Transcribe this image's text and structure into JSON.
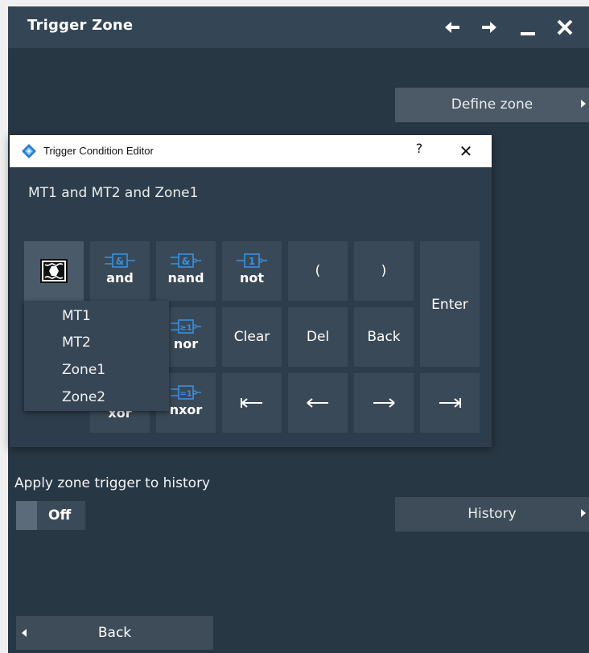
{
  "panel": {
    "title": "Trigger Zone",
    "define_zone_label": "Define zone",
    "apply_label": "Apply zone trigger to history",
    "toggle_state": "Off",
    "history_label": "History",
    "back_label": "Back"
  },
  "titlebar_icons": [
    "arrow-left-icon",
    "arrow-right-icon",
    "minimize-icon",
    "close-icon"
  ],
  "dialog": {
    "title": "Trigger Condition Editor",
    "help_label": "?",
    "close_label": "✕",
    "expression": "MT1 and MT2 and Zone1",
    "keys": {
      "and": "and",
      "nand": "nand",
      "not": "not",
      "open_paren": "(",
      "close_paren": ")",
      "enter": "Enter",
      "nor": "nor",
      "clear": "Clear",
      "del": "Del",
      "back": "Back",
      "xor": "xor",
      "nxor": "nxor"
    },
    "gate_symbols": {
      "and": "&",
      "nand": "&",
      "not": "1",
      "nor": "≥1",
      "nxor": "=1"
    },
    "source_options": [
      "MT1",
      "MT2",
      "Zone1",
      "Zone2"
    ]
  },
  "colors": {
    "panel_bg": "#283744",
    "titlebar_bg": "#344656",
    "button_bg": "#3a4957",
    "gate_icon_blue": "#3a8fdf"
  }
}
